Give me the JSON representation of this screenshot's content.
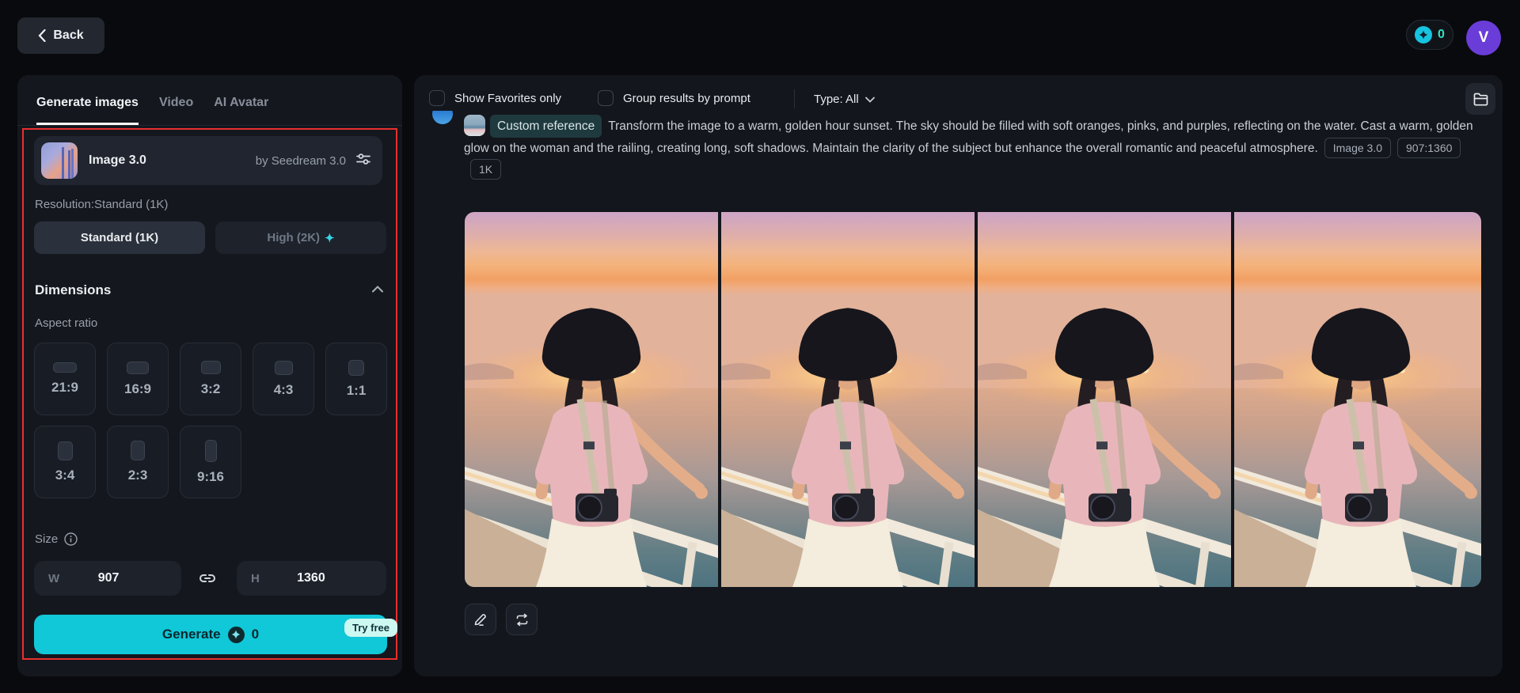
{
  "header": {
    "back_label": "Back",
    "credits_count": "0",
    "avatar_initial": "V"
  },
  "sidebar": {
    "tabs": [
      {
        "label": "Generate images"
      },
      {
        "label": "Video"
      },
      {
        "label": "AI Avatar"
      }
    ],
    "model": {
      "name": "Image 3.0",
      "byline": "by Seedream 3.0"
    },
    "resolution_label": "Resolution:Standard (1K)",
    "resolution_options": [
      {
        "label": "Standard (1K)"
      },
      {
        "label": "High (2K)",
        "sparkle": "✦"
      }
    ],
    "dimensions": {
      "title": "Dimensions",
      "aspect_ratio_label": "Aspect ratio",
      "ratios": [
        {
          "label": "21:9"
        },
        {
          "label": "16:9"
        },
        {
          "label": "3:2"
        },
        {
          "label": "4:3"
        },
        {
          "label": "1:1"
        },
        {
          "label": "3:4"
        },
        {
          "label": "2:3"
        },
        {
          "label": "9:16"
        }
      ],
      "size_label": "Size",
      "width_label": "W",
      "width_value": "907",
      "height_label": "H",
      "height_value": "1360"
    },
    "generate": {
      "label": "Generate",
      "cost": "0",
      "badge": "Try free"
    }
  },
  "main": {
    "filters": {
      "favorites_label": "Show Favorites only",
      "group_label": "Group results by prompt",
      "type_label": "Type: All"
    },
    "result": {
      "reference_tag": "Custom reference",
      "prompt": "Transform the image to a warm, golden hour sunset. The sky should be filled with soft oranges, pinks, and purples, reflecting on the water. Cast a warm, golden glow on the woman and the railing, creating long, soft shadows. Maintain the clarity of the subject but enhance the overall romantic and peaceful atmosphere.",
      "badges": [
        {
          "label": "Image 3.0"
        },
        {
          "label": "907:1360"
        },
        {
          "label": "1K"
        }
      ],
      "image_count": 4
    }
  },
  "colors": {
    "accent_cyan": "#10c8d8",
    "annotation_red": "#e8302e",
    "avatar_purple": "#6a3dd8",
    "credits_teal": "#35e0c0"
  }
}
